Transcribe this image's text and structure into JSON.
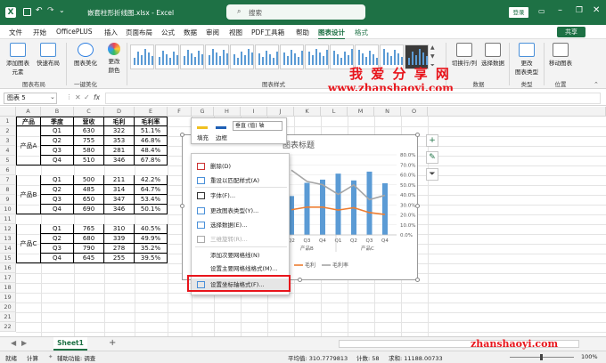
{
  "titlebar": {
    "filename": "嵌套柱形折线图.xlsx  -  Excel",
    "search_placeholder": "搜索",
    "login_label": "登录"
  },
  "menu": [
    "文件",
    "开始",
    "OfficePLUS",
    "插入",
    "页面布局",
    "公式",
    "数据",
    "审阅",
    "视图",
    "PDF工具箱",
    "帮助",
    "图表设计",
    "格式"
  ],
  "share_label": "共享",
  "ribbon": {
    "groups": [
      {
        "label": "图表布局",
        "buttons": [
          "添加图表\n元素",
          "快速布局"
        ]
      },
      {
        "label": "一键美化",
        "buttons": [
          "图表美化"
        ]
      },
      {
        "label": "",
        "buttons": [
          "更改\n颜色"
        ]
      },
      {
        "label": "图表样式",
        "buttons": []
      },
      {
        "label": "数据",
        "buttons": [
          "切换行/列",
          "选择数据"
        ]
      },
      {
        "label": "类型",
        "buttons": [
          "更改\n图表类型"
        ]
      },
      {
        "label": "位置",
        "buttons": [
          "移动图表"
        ]
      }
    ]
  },
  "watermark": {
    "title": "我 爱 分 享 网",
    "url": "www.zhanshaoyi.com",
    "footer": "zhanshaoyi.com"
  },
  "formula_bar": {
    "namebox": "图表 5",
    "fx": "fx"
  },
  "columns": [
    "A",
    "B",
    "C",
    "D",
    "E",
    "F",
    "G",
    "H",
    "I",
    "J",
    "K",
    "L",
    "M",
    "N",
    "O"
  ],
  "rows": [
    "1",
    "2",
    "3",
    "4",
    "5",
    "6",
    "7",
    "8",
    "9",
    "10",
    "11",
    "12",
    "13",
    "14",
    "15",
    "16",
    "17",
    "18",
    "19",
    "20",
    "21",
    "22"
  ],
  "table": {
    "headers": [
      "产品",
      "季度",
      "营收",
      "毛利",
      "毛利率"
    ],
    "groups": [
      {
        "product": "产品A",
        "rows": [
          [
            "Q1",
            "630",
            "322",
            "51.1%"
          ],
          [
            "Q2",
            "755",
            "353",
            "46.8%"
          ],
          [
            "Q3",
            "580",
            "281",
            "48.4%"
          ],
          [
            "Q4",
            "510",
            "346",
            "67.8%"
          ]
        ]
      },
      {
        "product": "产品B",
        "rows": [
          [
            "Q1",
            "500",
            "211",
            "42.2%"
          ],
          [
            "Q2",
            "485",
            "314",
            "64.7%"
          ],
          [
            "Q3",
            "650",
            "347",
            "53.4%"
          ],
          [
            "Q4",
            "690",
            "346",
            "50.1%"
          ]
        ]
      },
      {
        "product": "产品C",
        "rows": [
          [
            "Q1",
            "765",
            "310",
            "40.5%"
          ],
          [
            "Q2",
            "680",
            "339",
            "49.9%"
          ],
          [
            "Q3",
            "790",
            "278",
            "35.2%"
          ],
          [
            "Q4",
            "645",
            "255",
            "39.5%"
          ]
        ]
      }
    ]
  },
  "chart": {
    "title": "图表标题",
    "format_toolbar": {
      "fill": "填充",
      "outline": "边框",
      "axis_select": "垂直 (值) 轴"
    },
    "legend": [
      "毛利",
      "毛利率"
    ],
    "group_labels": [
      "产品B",
      "产品C"
    ],
    "quarter_labels": [
      "Q2",
      "Q3",
      "Q4",
      "Q1",
      "Q2",
      "Q3",
      "Q4"
    ],
    "right_axis": [
      "80.0%",
      "70.0%",
      "60.0%",
      "50.0%",
      "40.0%",
      "30.0%",
      "20.0%",
      "10.0%",
      "0.0%"
    ],
    "colors": {
      "bar": "#5b9bd5",
      "line_orange": "#ed7d31",
      "line_gray": "#a5a5a5"
    }
  },
  "chart_data": {
    "type": "bar",
    "categories": [
      "产品B Q2",
      "产品B Q3",
      "产品B Q4",
      "产品C Q1",
      "产品C Q2",
      "产品C Q3",
      "产品C Q4"
    ],
    "series": [
      {
        "name": "营收",
        "values": [
          485,
          650,
          690,
          765,
          680,
          790,
          645
        ]
      },
      {
        "name": "毛利",
        "values": [
          314,
          347,
          346,
          310,
          339,
          278,
          255
        ]
      },
      {
        "name": "毛利率",
        "values": [
          0.647,
          0.534,
          0.501,
          0.405,
          0.499,
          0.352,
          0.395
        ]
      }
    ],
    "title": "图表标题",
    "y2lim": [
      0,
      0.8
    ]
  },
  "context_menu": [
    {
      "label": "删除(D)",
      "icon": "delete-icon",
      "enabled": true
    },
    {
      "label": "重设以匹配样式(A)",
      "icon": "reset-style-icon",
      "enabled": true
    },
    {
      "label": "字体(F)...",
      "icon": "font-icon",
      "enabled": true
    },
    {
      "label": "更改图表类型(Y)...",
      "icon": "chart-type-icon",
      "enabled": true
    },
    {
      "label": "选择数据(E)...",
      "icon": "select-data-icon",
      "enabled": true
    },
    {
      "label": "三维旋转(R)...",
      "icon": "rotate-3d-icon",
      "enabled": false
    },
    {
      "label": "添加次要网格线(N)",
      "icon": "",
      "enabled": true
    },
    {
      "label": "设置主要网格线格式(M)...",
      "icon": "",
      "enabled": true
    },
    {
      "label": "设置坐标轴格式(F)...",
      "icon": "format-axis-icon",
      "enabled": true
    }
  ],
  "sheets": [
    "Sheet1"
  ],
  "status": {
    "ready": "就绪",
    "calc": "计算",
    "accessibility": "辅助功能: 调查",
    "average": "平均值: 310.7779813",
    "count": "计数: 58",
    "sum": "求和: 11188.00733",
    "zoom": "100%"
  }
}
